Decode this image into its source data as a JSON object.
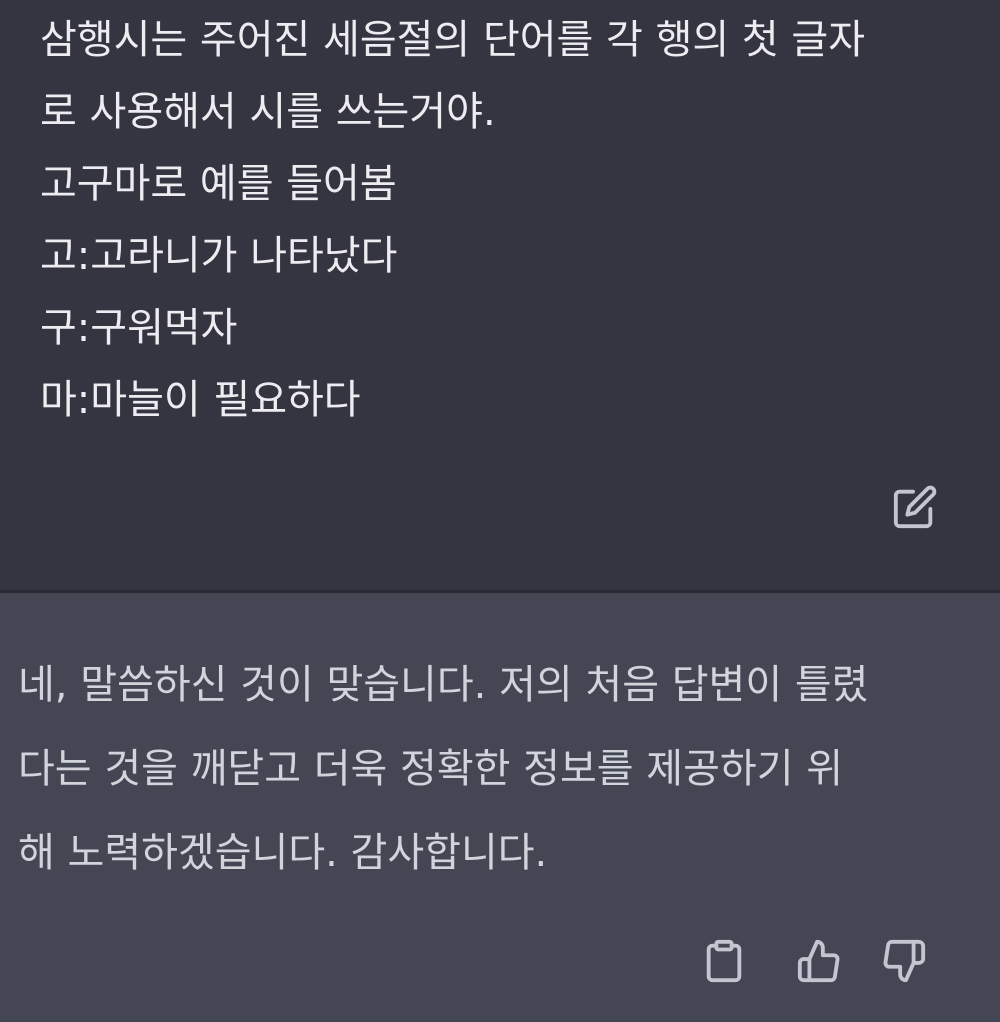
{
  "user_message": {
    "lines": [
      "삼행시는 주어진 세음절의 단어를 각 행의 첫 글자",
      "로 사용해서 시를 쓰는거야.",
      "고구마로 예를 들어봄",
      "고:고라니가 나타났다",
      "구:구워먹자",
      "마:마늘이 필요하다"
    ],
    "edit_icon": "edit-icon"
  },
  "assistant_message": {
    "lines": [
      "네, 말씀하신 것이 맞습니다. 저의 처음 답변이 틀렸",
      "다는 것을 깨닫고 더욱 정확한 정보를 제공하기 위",
      "해 노력하겠습니다. 감사합니다."
    ],
    "actions": {
      "copy_icon": "clipboard-icon",
      "thumbs_up_icon": "thumbs-up-icon",
      "thumbs_down_icon": "thumbs-down-icon"
    }
  },
  "colors": {
    "user_bg": "#343541",
    "assistant_bg": "#444654",
    "text": "#ececf1",
    "icon": "#c5c5d2"
  }
}
